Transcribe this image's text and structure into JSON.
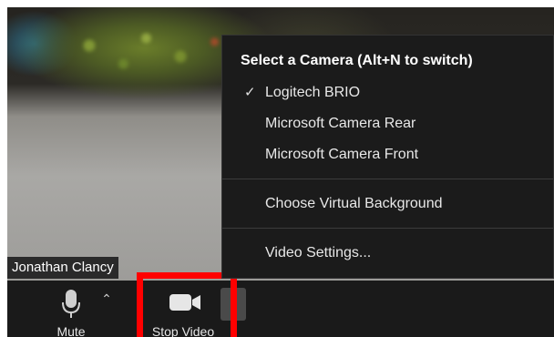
{
  "participant": {
    "name": "Jonathan Clancy"
  },
  "toolbar": {
    "mute_label": "Mute",
    "mute_icon": "microphone-icon",
    "video_label": "Stop Video",
    "video_icon": "video-camera-icon"
  },
  "camera_menu": {
    "title": "Select a Camera (Alt+N to switch)",
    "cameras": [
      {
        "label": "Logitech BRIO",
        "checked": true
      },
      {
        "label": "Microsoft Camera Rear",
        "checked": false
      },
      {
        "label": "Microsoft Camera Front",
        "checked": false
      }
    ],
    "virtual_background_label": "Choose Virtual Background",
    "video_settings_label": "Video Settings..."
  },
  "colors": {
    "highlight": "#ff0000",
    "menu_background": "#1b1b1b",
    "toolbar_background": "#1a1a1a"
  }
}
